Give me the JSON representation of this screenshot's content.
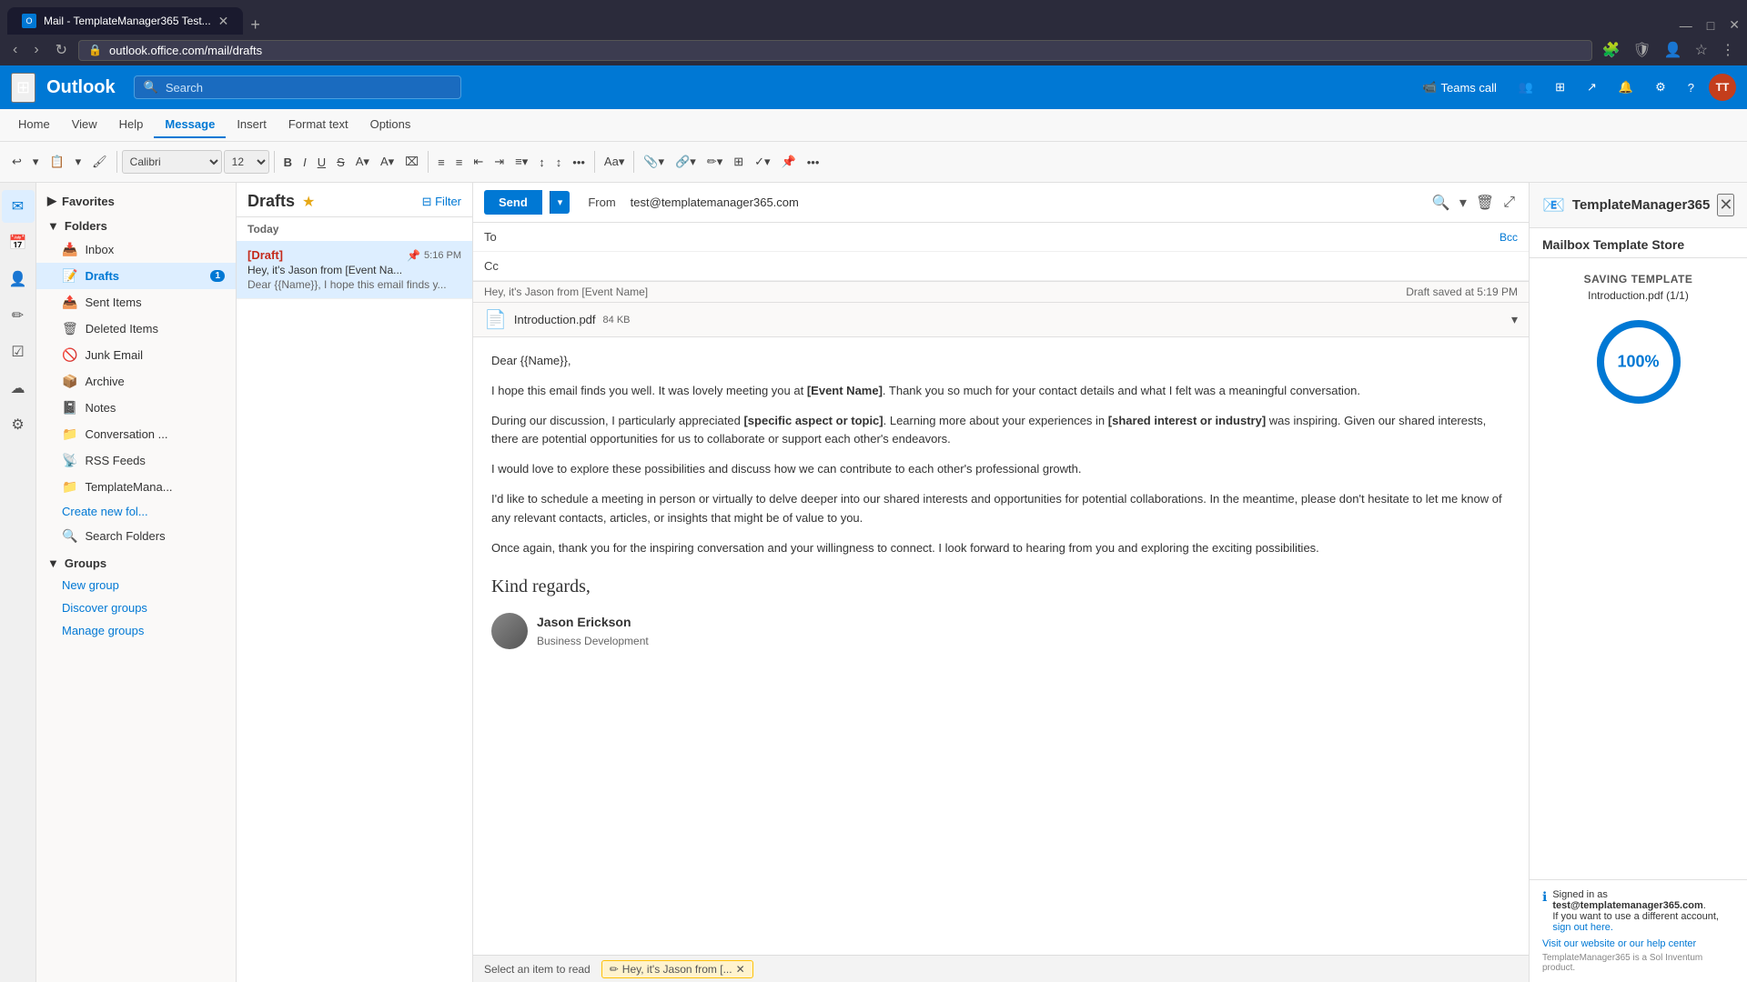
{
  "browser": {
    "tab_title": "Mail - TemplateManager365 Test...",
    "url": "outlook.office.com/mail/drafts",
    "new_tab_label": "+",
    "back_label": "←",
    "forward_label": "→",
    "refresh_label": "↻",
    "minimize": "—",
    "maximize": "□",
    "close_x": "✕"
  },
  "header": {
    "waffle": "⊞",
    "app_name": "Outlook",
    "search_placeholder": "Search",
    "teams_call_label": "Teams call",
    "avatar_initials": "TT"
  },
  "ribbon": {
    "tabs": [
      "Home",
      "View",
      "Help",
      "Message",
      "Insert",
      "Format text",
      "Options"
    ],
    "active_tab": "Message",
    "font_family": "Calibri",
    "font_size": "12"
  },
  "sidebar_icons": [
    "✉",
    "📅",
    "👤",
    "✏",
    "☑",
    "☁",
    "⚙"
  ],
  "nav": {
    "favorites_label": "Favorites",
    "folders_label": "Folders",
    "folders_items": [
      {
        "name": "Inbox",
        "icon": "📥",
        "badge": null
      },
      {
        "name": "Drafts",
        "icon": "📝",
        "badge": "1"
      },
      {
        "name": "Sent Items",
        "icon": "📤",
        "badge": null
      },
      {
        "name": "Deleted Items",
        "icon": "🗑",
        "badge": null
      },
      {
        "name": "Junk Email",
        "icon": "🚫",
        "badge": null
      },
      {
        "name": "Archive",
        "icon": "📦",
        "badge": null
      },
      {
        "name": "Notes",
        "icon": "📓",
        "badge": null
      },
      {
        "name": "Conversation ...",
        "icon": "📁",
        "badge": null
      },
      {
        "name": "RSS Feeds",
        "icon": "📡",
        "badge": null
      },
      {
        "name": "TemplateMana...",
        "icon": "📁",
        "badge": null
      }
    ],
    "create_folder_label": "Create new fol...",
    "search_folders_label": "Search Folders",
    "groups_label": "Groups",
    "new_group_label": "New group",
    "discover_groups_label": "Discover groups",
    "manage_groups_label": "Manage groups"
  },
  "email_list": {
    "folder_name": "Drafts",
    "filter_label": "Filter",
    "date_divider": "Today",
    "email": {
      "sender": "[Draft]",
      "time": "5:16 PM",
      "subject": "Hey, it's Jason from [Event Na...",
      "preview": "Dear {{Name}}, I hope this email finds y..."
    }
  },
  "compose": {
    "send_label": "Send",
    "from_label": "From",
    "from_email": "test@templatemanager365.com",
    "to_label": "To",
    "cc_label": "Cc",
    "bcc_label": "Bcc",
    "draft_saved": "Draft saved at 5:19 PM",
    "subject": "Hey, it's Jason from [Event Name]",
    "attachment": {
      "name": "Introduction.pdf",
      "size": "84 KB"
    },
    "body_lines": [
      "Dear {{Name}},",
      "",
      "I hope this email finds you well. It was lovely meeting you at [Event Name]. Thank you so much for your contact details and what I felt was a meaningful conversation.",
      "",
      "During our discussion, I particularly appreciated [specific aspect or topic]. Learning more about your experiences in [shared interest or industry] was inspiring. Given our shared interests, there are potential opportunities for us to collaborate or support each other's endeavors.",
      "",
      "I would love to explore these possibilities and discuss how we can contribute to each other's professional growth.",
      "",
      "I'd like to schedule a meeting in person or virtually to delve deeper into our shared interests and opportunities for potential collaborations. In the meantime, please don't hesitate to let me know of any relevant contacts, articles, or insights that might be of value to you.",
      "",
      "Once again, thank you for the inspiring conversation and your willingness to connect. I look forward to hearing from you and exploring the exciting possibilities."
    ],
    "signature_text": "Kind regards,",
    "signature_name": "Jason Erickson",
    "signature_title": "Business Development"
  },
  "bottom_bar": {
    "select_item": "Select an item to read",
    "draft_label": "Hey, it's Jason from [..."
  },
  "template_store": {
    "logo_icon": "📧",
    "app_name": "TemplateManager365",
    "panel_title": "Mailbox Template Store",
    "close_icon": "✕",
    "saving_label": "SAVING TEMPLATE",
    "saving_filename": "Introduction.pdf (1/1)",
    "progress_percent": 100,
    "progress_label": "100%",
    "signed_in_label": "Signed in as",
    "signed_in_email": "test@templatemanager365.com",
    "switch_account_text": "If you want to use a different account, sign out here.",
    "visit_website_label": "Visit our website or our help center",
    "product_label": "TemplateManager365 is a Sol Inventum product."
  }
}
